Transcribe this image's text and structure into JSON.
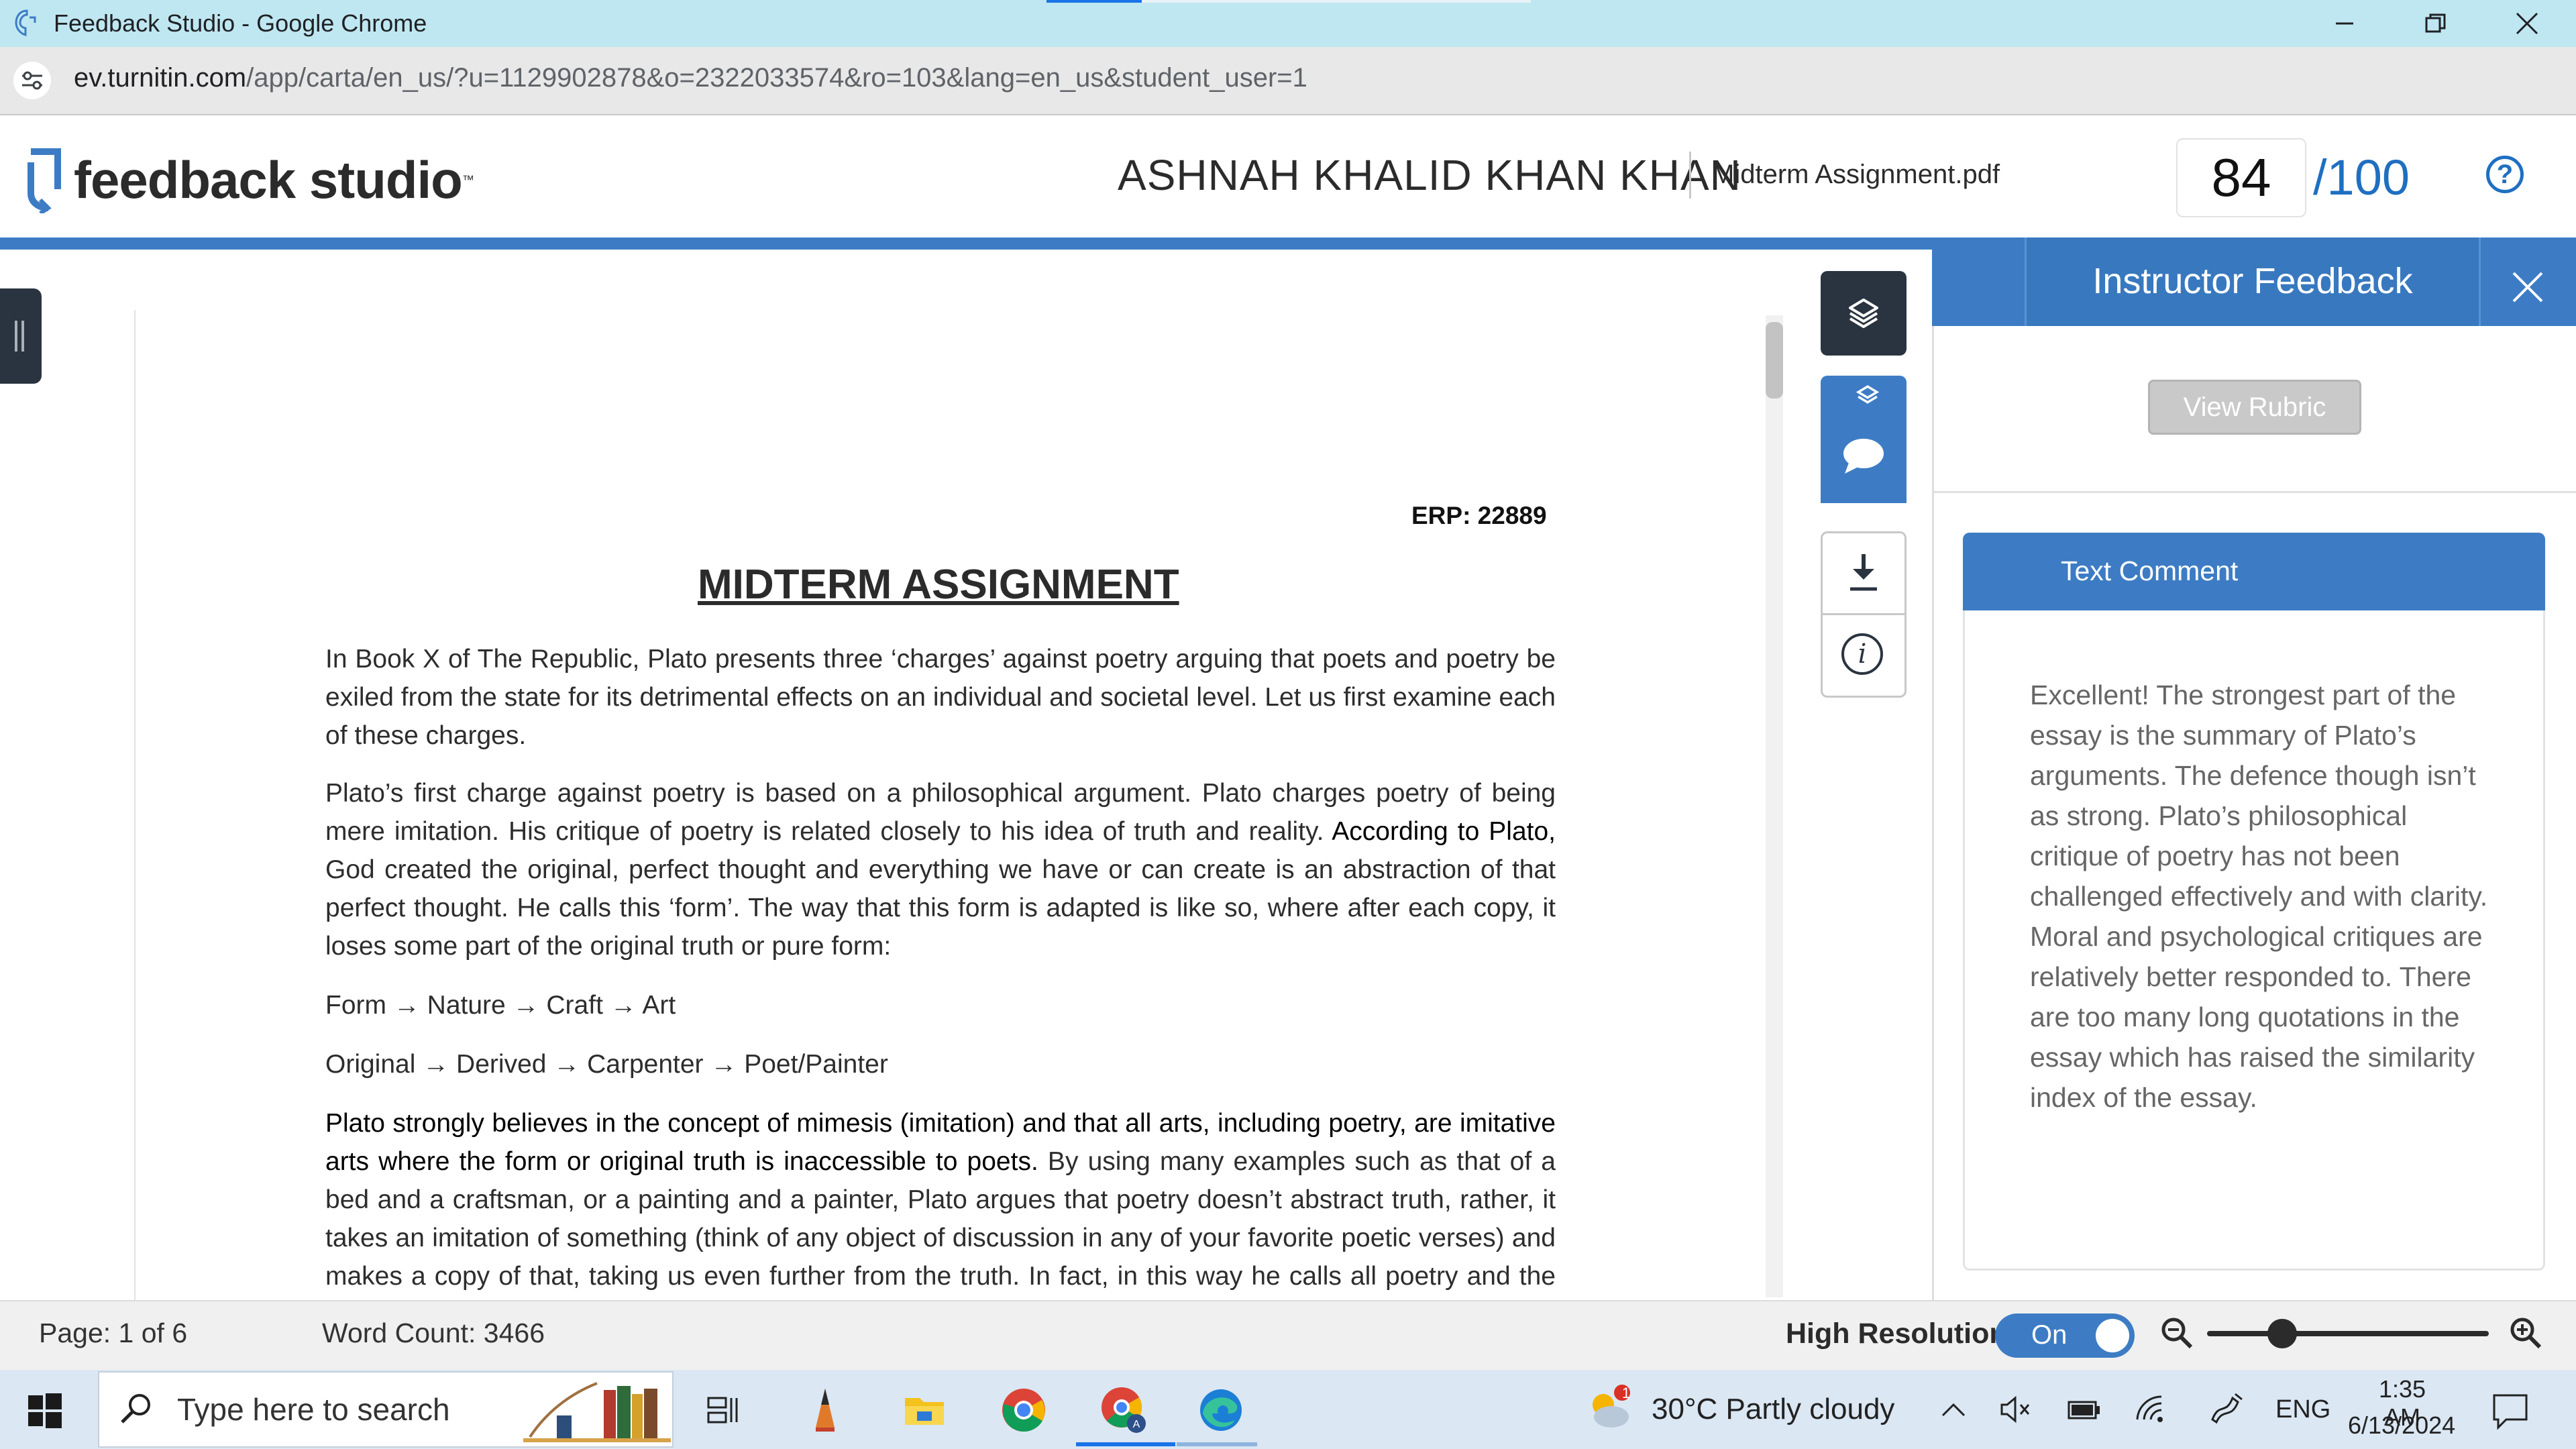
{
  "browser": {
    "window_title": "Feedback Studio - Google Chrome",
    "url_host": "ev.turnitin.com",
    "url_path": "/app/carta/en_us/?u=1129902878&o=2322033574&ro=103&lang=en_us&student_user=1"
  },
  "header": {
    "logo_text": "feedback studio",
    "student_name": "ASHNAH KHALID KHAN KHAN",
    "file_name": "Midterm Assignment.pdf",
    "score": "84",
    "score_total": "/100",
    "help_glyph": "?"
  },
  "document": {
    "erp": "ERP: 22889",
    "title": "MIDTERM ASSIGNMENT",
    "p1": "In Book X of The Republic, Plato presents three ‘charges’ against poetry arguing that poets and poetry be exiled from the state for its detrimental effects on an individual and societal level. Let us first examine each of these charges.",
    "p2a": "Plato’s first charge against poetry is based on a philosophical argument. Plato charges poetry of being mere imitation. His critique of poetry is related closely to his idea of truth and reality. ",
    "p2b": "According to Plato,",
    "p2c": " God created the original, perfect thought and everything we have or can create is an abstraction of that perfect thought. He calls this ‘form’.  The way that this form is adapted is like so, where after each copy, it loses some part of the original truth or pure form:",
    "p3": "Form → Nature → Craft → Art",
    "p4": "Original → Derived → Carpenter → Poet/Painter",
    "p5a": "Plato strongly believes in the concept of mimesis (imitation) and that all arts, including poetry, are imitative arts where the form or original truth is inaccessible to poets.",
    "p5b": " By using many examples such as that of a bed and a craftsman, or a painting and a painter, Plato argues that poetry doesn’t abstract truth, rather, it takes an imitation of something (think of any object of discussion in any of your favorite poetic verses) and makes a copy of that, taking us even further from the truth. In fact, in this way he calls all poetry and the works of"
  },
  "tools": {
    "layers": "layers-icon",
    "comment": "comment-bubble-icon",
    "download": "download-icon",
    "info": "info-icon",
    "info_glyph": "i"
  },
  "panel": {
    "title": "Instructor Feedback",
    "rubric_button": "View Rubric",
    "comment_header": "Text Comment",
    "comment_body": "Excellent! The strongest part of the essay is the summary of Plato’s arguments. The defence though isn’t as strong. Plato’s philosophical critique of poetry has not been challenged effectively and with clarity. Moral and psychological critiques are relatively better responded to. There are too many long quotations in the essay which has raised the similarity index of the essay."
  },
  "status": {
    "page": "Page: 1 of 6",
    "word_count": "Word Count: 3466",
    "high_resolution_label": "High Resolution",
    "high_resolution_state": "On"
  },
  "taskbar": {
    "search_placeholder": "Type here to search",
    "weather": "30°C  Partly cloudy",
    "weather_badge": "1",
    "language": "ENG",
    "time": "1:35 AM",
    "date": "6/13/2024"
  },
  "colors": {
    "brand_blue": "#3d7cc4",
    "dark_tool": "#2a3440",
    "score_blue": "#1f6fc1"
  }
}
